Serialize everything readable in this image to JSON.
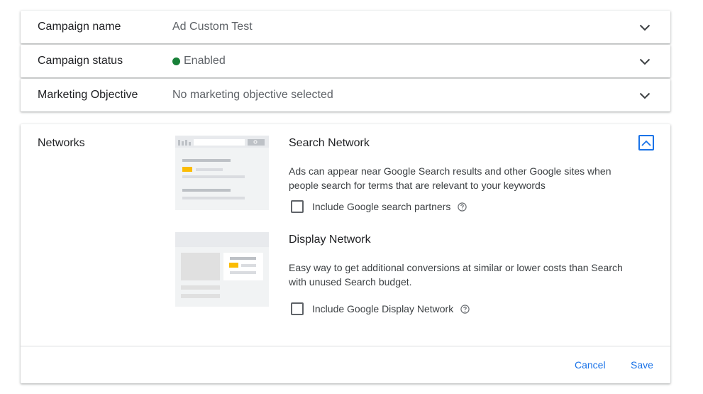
{
  "rows": [
    {
      "label": "Campaign name",
      "value": "Ad Custom Test"
    },
    {
      "label": "Campaign status",
      "value": "Enabled",
      "status_color": "#188038"
    },
    {
      "label": "Marketing Objective",
      "value": "No marketing objective selected"
    }
  ],
  "networks": {
    "label": "Networks",
    "search": {
      "title": "Search Network",
      "description": "Ads can appear near Google Search results and other Google sites when people search for terms that are relevant to your keywords",
      "checkbox_label": "Include Google search partners",
      "checked": false,
      "thumbnail_icon": "search-network-illustration"
    },
    "display": {
      "title": "Display Network",
      "description": "Easy way to get additional conversions at similar or lower costs than Search with unused Search budget.",
      "checkbox_label": "Include Google Display Network",
      "checked": false,
      "thumbnail_icon": "display-network-illustration"
    }
  },
  "footer": {
    "cancel_label": "Cancel",
    "save_label": "Save"
  },
  "colors": {
    "accent": "#1a73e8",
    "enabled": "#188038",
    "highlight": "#fbbc04"
  }
}
